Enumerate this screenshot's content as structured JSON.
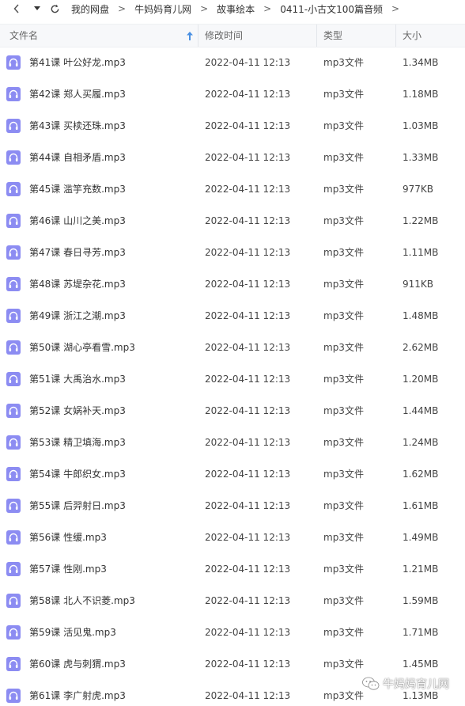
{
  "toolbar": {
    "back_icon": "chevron-left-icon",
    "dropdown_icon": "caret-down-icon",
    "refresh_icon": "refresh-icon"
  },
  "breadcrumb": [
    {
      "label": "我的网盘"
    },
    {
      "label": "牛妈妈育儿网"
    },
    {
      "label": "故事绘本"
    },
    {
      "label": "0411-小古文100篇音频"
    }
  ],
  "breadcrumb_separator": ">",
  "columns": {
    "name": "文件名",
    "modified": "修改时间",
    "type": "类型",
    "size": "大小"
  },
  "sort": {
    "column": "name",
    "direction": "asc",
    "icon": "sort-up-arrow-icon"
  },
  "files": [
    {
      "name": "第41课 叶公好龙.mp3",
      "modified": "2022-04-11 12:13",
      "type": "mp3文件",
      "size": "1.34MB"
    },
    {
      "name": "第42课 郑人买履.mp3",
      "modified": "2022-04-11 12:13",
      "type": "mp3文件",
      "size": "1.18MB"
    },
    {
      "name": "第43课 买椟还珠.mp3",
      "modified": "2022-04-11 12:13",
      "type": "mp3文件",
      "size": "1.03MB"
    },
    {
      "name": "第44课 自相矛盾.mp3",
      "modified": "2022-04-11 12:13",
      "type": "mp3文件",
      "size": "1.33MB"
    },
    {
      "name": "第45课 滥竽充数.mp3",
      "modified": "2022-04-11 12:13",
      "type": "mp3文件",
      "size": "977KB"
    },
    {
      "name": "第46课 山川之美.mp3",
      "modified": "2022-04-11 12:13",
      "type": "mp3文件",
      "size": "1.22MB"
    },
    {
      "name": "第47课 春日寻芳.mp3",
      "modified": "2022-04-11 12:13",
      "type": "mp3文件",
      "size": "1.11MB"
    },
    {
      "name": "第48课 苏堤杂花.mp3",
      "modified": "2022-04-11 12:13",
      "type": "mp3文件",
      "size": "911KB"
    },
    {
      "name": "第49课 浙江之潮.mp3",
      "modified": "2022-04-11 12:13",
      "type": "mp3文件",
      "size": "1.48MB"
    },
    {
      "name": "第50课 湖心亭看雪.mp3",
      "modified": "2022-04-11 12:13",
      "type": "mp3文件",
      "size": "2.62MB"
    },
    {
      "name": "第51课 大禹治水.mp3",
      "modified": "2022-04-11 12:13",
      "type": "mp3文件",
      "size": "1.20MB"
    },
    {
      "name": "第52课 女娲补天.mp3",
      "modified": "2022-04-11 12:13",
      "type": "mp3文件",
      "size": "1.44MB"
    },
    {
      "name": "第53课 精卫填海.mp3",
      "modified": "2022-04-11 12:13",
      "type": "mp3文件",
      "size": "1.24MB"
    },
    {
      "name": "第54课 牛郎织女.mp3",
      "modified": "2022-04-11 12:13",
      "type": "mp3文件",
      "size": "1.62MB"
    },
    {
      "name": "第55课 后羿射日.mp3",
      "modified": "2022-04-11 12:13",
      "type": "mp3文件",
      "size": "1.61MB"
    },
    {
      "name": "第56课 性缓.mp3",
      "modified": "2022-04-11 12:13",
      "type": "mp3文件",
      "size": "1.49MB"
    },
    {
      "name": "第57课 性刚.mp3",
      "modified": "2022-04-11 12:13",
      "type": "mp3文件",
      "size": "1.21MB"
    },
    {
      "name": "第58课 北人不识菱.mp3",
      "modified": "2022-04-11 12:13",
      "type": "mp3文件",
      "size": "1.59MB"
    },
    {
      "name": "第59课 活见鬼.mp3",
      "modified": "2022-04-11 12:13",
      "type": "mp3文件",
      "size": "1.71MB"
    },
    {
      "name": "第60课 虎与刺猬.mp3",
      "modified": "2022-04-11 12:13",
      "type": "mp3文件",
      "size": "1.45MB"
    },
    {
      "name": "第61课 李广射虎.mp3",
      "modified": "2022-04-11 12:13",
      "type": "mp3文件",
      "size": "1.13MB"
    }
  ],
  "file_icon": "audio-file-icon",
  "watermark": {
    "text": "牛妈妈育儿网",
    "icon": "wechat-icon"
  },
  "colors": {
    "file_icon": "#8c8cf2",
    "sort_arrow": "#4a90e2",
    "header_bg": "#f7f8fa"
  }
}
